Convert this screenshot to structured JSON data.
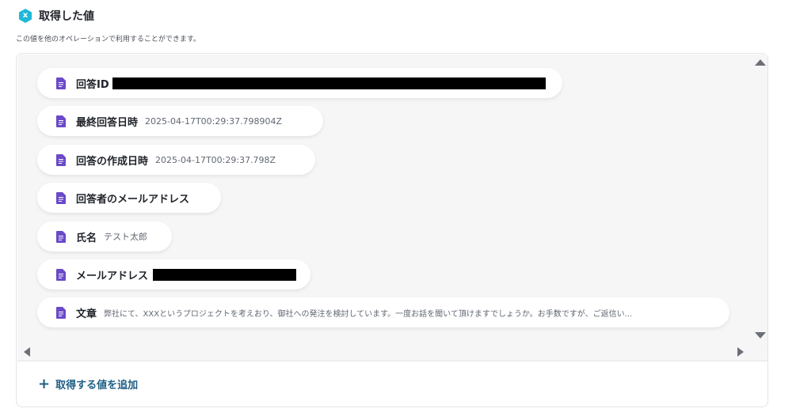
{
  "header": {
    "icon_letter": "x",
    "title": "取得した値",
    "description": "この値を他のオペレーションで利用することができます。"
  },
  "items": [
    {
      "label": "回答ID",
      "value": "",
      "redacted": true
    },
    {
      "label": "最終回答日時",
      "value": "2025-04-17T00:29:37.798904Z",
      "redacted": false
    },
    {
      "label": "回答の作成日時",
      "value": "2025-04-17T00:29:37.798Z",
      "redacted": false
    },
    {
      "label": "回答者のメールアドレス",
      "value": "",
      "redacted": false
    },
    {
      "label": "氏名",
      "value": "テスト太郎",
      "redacted": false
    },
    {
      "label": "メールアドレス",
      "value": "",
      "redacted": true
    },
    {
      "label": "文章",
      "value": "弊社にて、XXXというプロジェクトを考えおり、御社への発注を検討しています。一度お話を聞いて頂けますでしょうか。お手数ですが、ご返信い...",
      "redacted": false
    }
  ],
  "footer": {
    "add_label": "取得する値を追加"
  },
  "colors": {
    "header_icon": "#1fb8d8",
    "doc_icon": "#6b49c8",
    "add_button": "#1f5f85"
  },
  "icons": {
    "header": "hexagon-x-icon",
    "item": "document-icon",
    "add": "plus-icon"
  }
}
